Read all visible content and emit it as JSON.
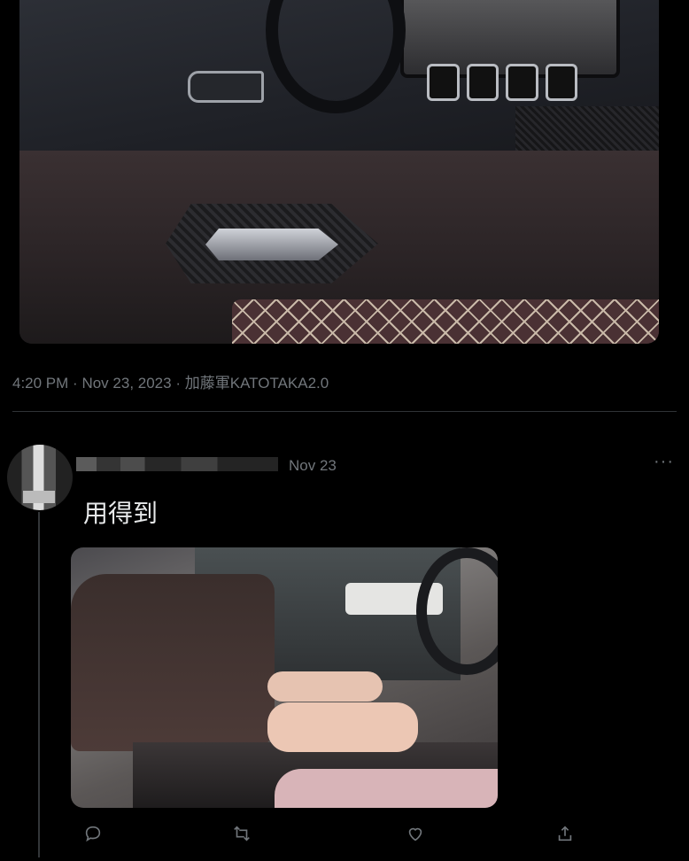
{
  "main_tweet": {
    "time": "4:20 PM",
    "date": "Nov 23, 2023",
    "source": "加藤軍KATOTAKA2.0",
    "separator": "·"
  },
  "reply": {
    "date": "Nov 23",
    "text": "用得到",
    "more_icon": "more-horizontal-icon"
  },
  "actions": {
    "reply_icon": "reply-icon",
    "retweet_icon": "retweet-icon",
    "like_icon": "like-icon",
    "share_icon": "share-icon"
  },
  "colors": {
    "background": "#000000",
    "text": "#e7e9ea",
    "muted": "#71767b",
    "divider": "#2f3336"
  }
}
